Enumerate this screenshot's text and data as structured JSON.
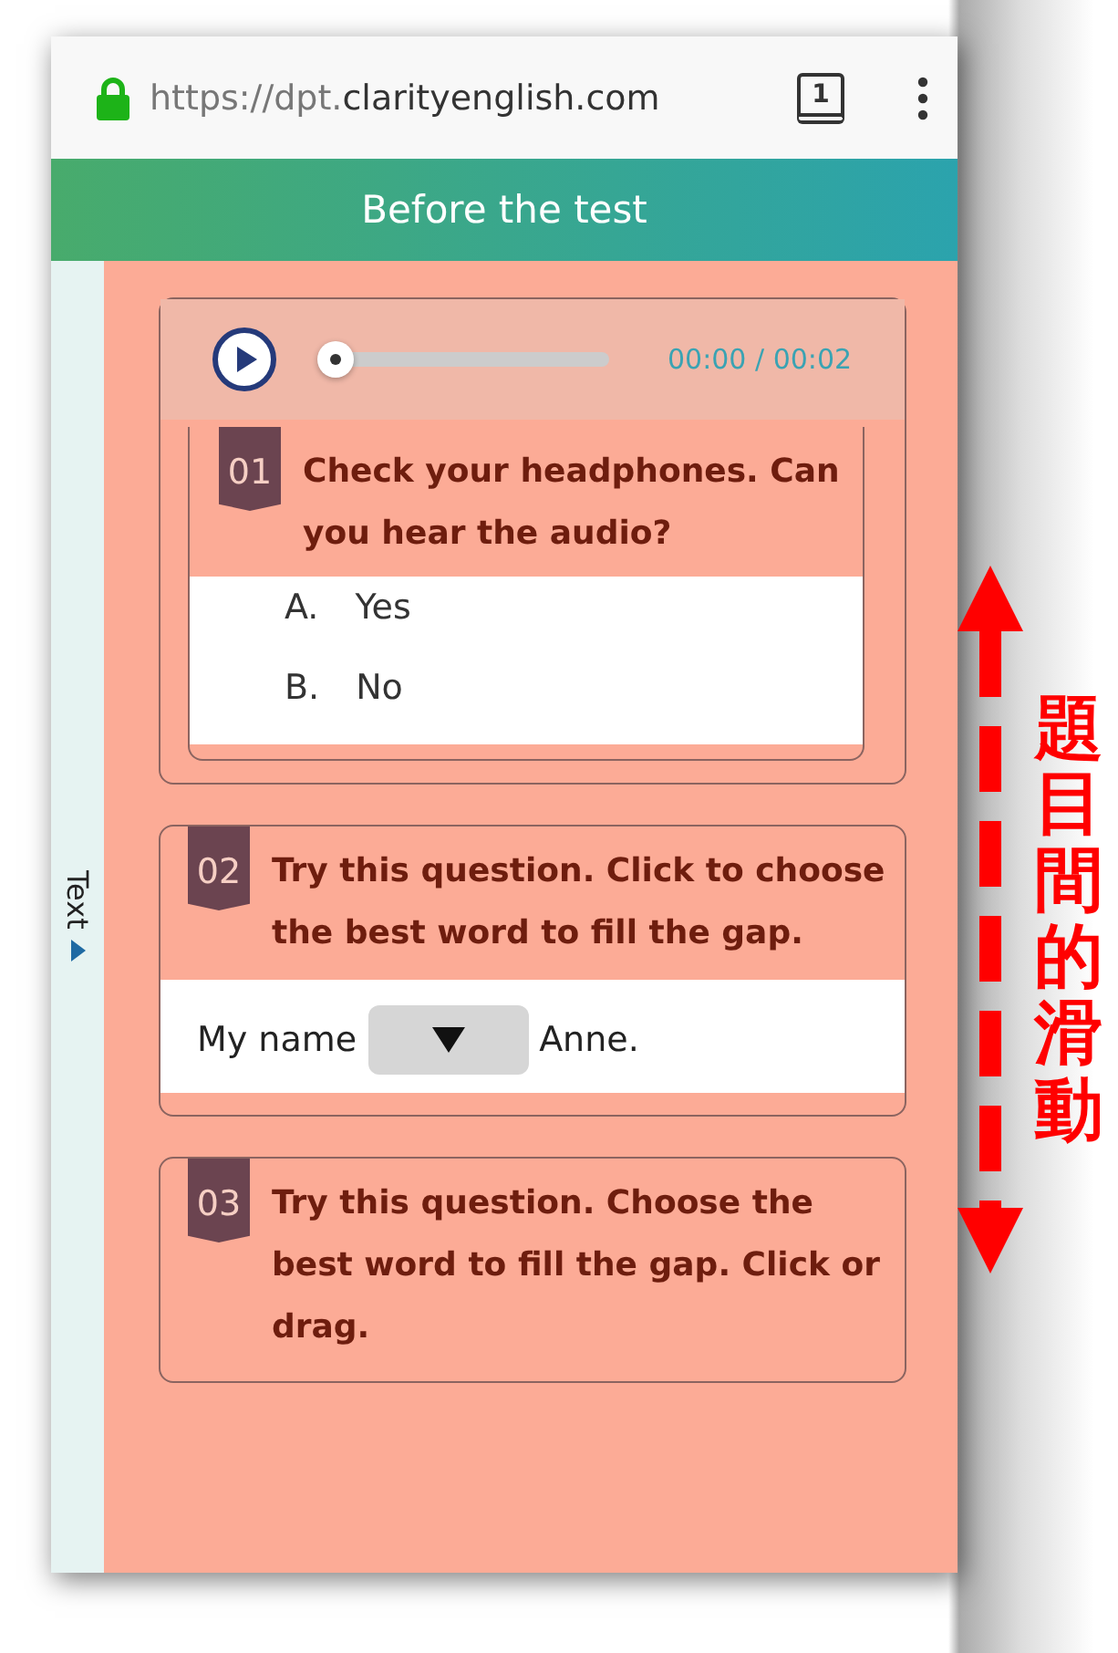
{
  "browser": {
    "url_prefix": "https://dpt.",
    "url_domain": "clarityenglish.com",
    "tab_count": "1"
  },
  "header": {
    "title": "Before the test"
  },
  "side_tab": {
    "label": "Text"
  },
  "audio": {
    "level": 0,
    "time": "00:00 / 00:02"
  },
  "questions": [
    {
      "number": "01",
      "kind": "choice",
      "prompt": "Check your headphones. Can you hear the audio?",
      "options": [
        {
          "letter": "A.",
          "text": "Yes"
        },
        {
          "letter": "B.",
          "text": "No"
        }
      ]
    },
    {
      "number": "02",
      "kind": "gap",
      "prompt": "Try this question. Click to choose the best word to fill the gap.",
      "before": "My name",
      "after": "Anne."
    },
    {
      "number": "03",
      "kind": "drag",
      "prompt": "Try this question. Choose the best word to fill the gap. Click or drag."
    }
  ],
  "annotation": {
    "text": "題目間的滑動"
  }
}
